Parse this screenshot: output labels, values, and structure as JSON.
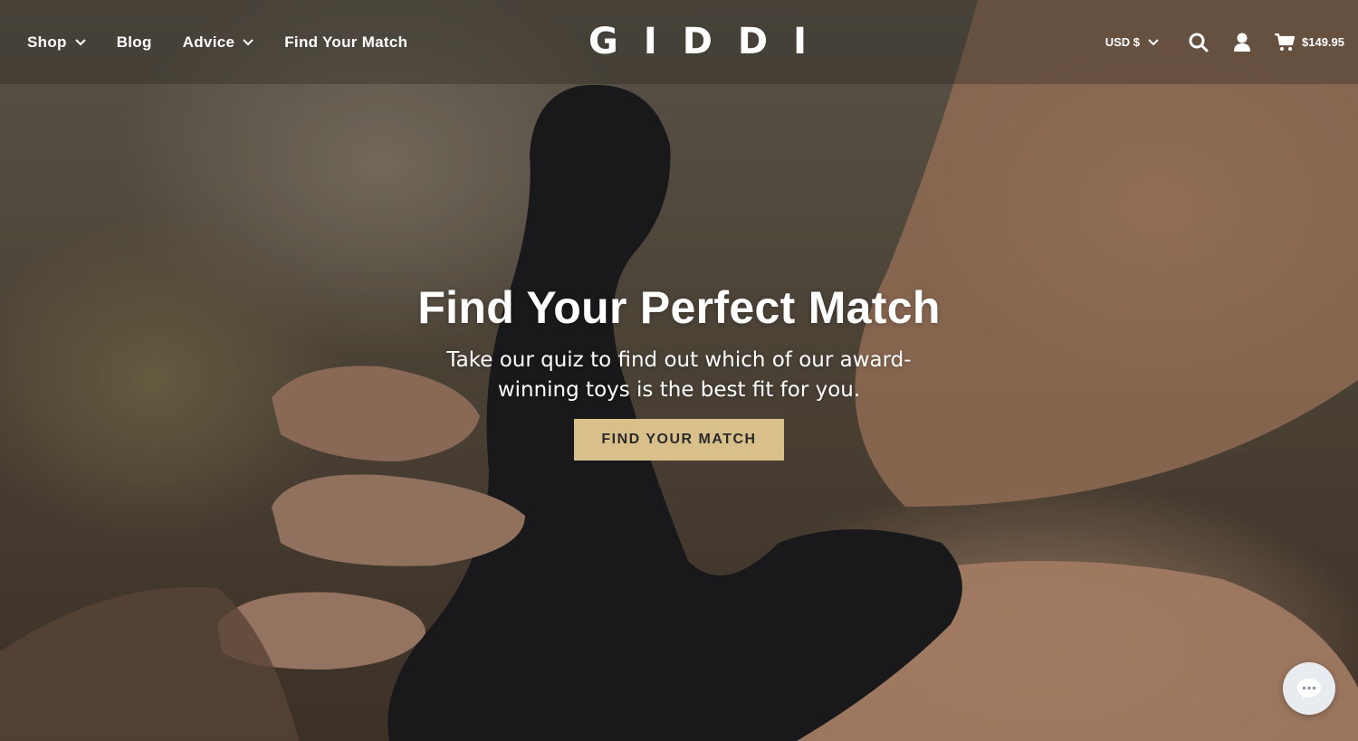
{
  "header": {
    "nav": [
      {
        "label": "Shop",
        "has_dropdown": true
      },
      {
        "label": "Blog",
        "has_dropdown": false
      },
      {
        "label": "Advice",
        "has_dropdown": true
      },
      {
        "label": "Find Your Match",
        "has_dropdown": false
      }
    ],
    "logo": "GIDDI",
    "currency": "USD $",
    "icons": [
      "search-icon",
      "user-icon",
      "cart-icon"
    ],
    "cart_total": "$149.95"
  },
  "hero": {
    "title": "Find Your Perfect Match",
    "subtitle": "Take our quiz to find out which of our award-winning toys is the best fit for you.",
    "cta_label": "FIND YOUR MATCH",
    "cta_color": "#d9c08a"
  },
  "chat": {
    "icon": "chat-icon"
  }
}
